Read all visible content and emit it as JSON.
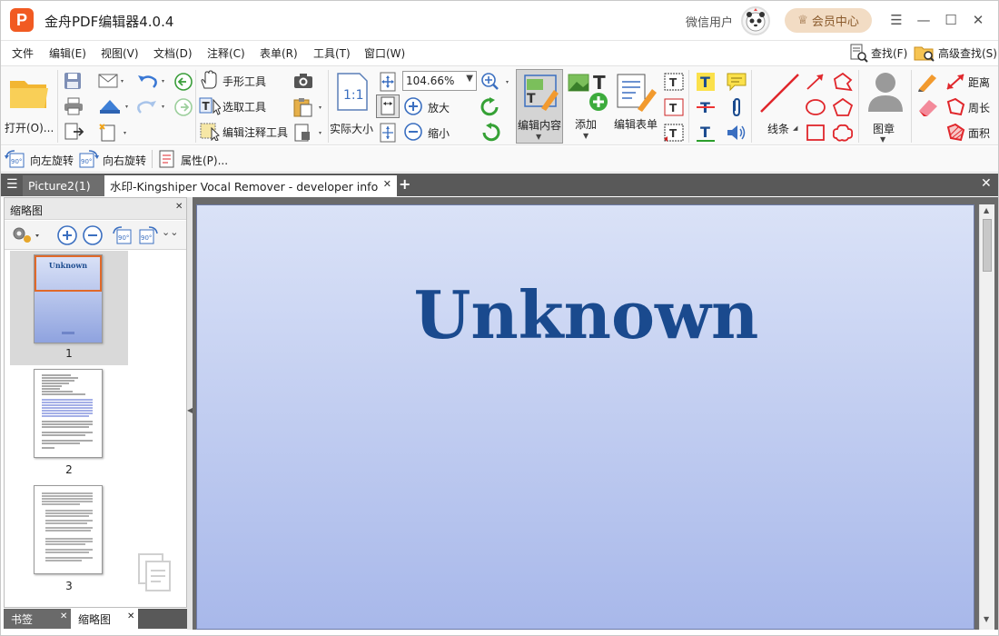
{
  "app": {
    "title": "金舟PDF编辑器4.0.4",
    "logo_letter": "P",
    "user": "微信用户",
    "vip_label": "会员中心",
    "brand_color": "#f15a22"
  },
  "window_controls": {
    "menu": "☰",
    "minimize": "—",
    "maximize": "☐",
    "close": "✕"
  },
  "menu": {
    "items": [
      "文件",
      "编辑(E)",
      "视图(V)",
      "文档(D)",
      "注释(C)",
      "表单(R)",
      "工具(T)",
      "窗口(W)"
    ],
    "find": "查找(F)",
    "advanced_find": "高级查找(S)"
  },
  "ribbon": {
    "open": "打开(O)...",
    "hand_tool": "手形工具",
    "select_tool": "选取工具",
    "edit_annot_tool": "编辑注释工具",
    "actual_size": "实际大小",
    "zoom_value": "104.66%",
    "zoom_in": "放大",
    "zoom_out": "缩小",
    "edit_content": "编辑内容",
    "add": "添加",
    "edit_form": "编辑表单",
    "line": "线条",
    "stamp": "图章",
    "distance": "距离",
    "perimeter": "周长",
    "area": "面积"
  },
  "quickbar": {
    "rotate_left": "向左旋转",
    "rotate_right": "向右旋转",
    "properties": "属性(P)..."
  },
  "tabs": [
    {
      "label": "Picture2(1)",
      "active": false
    },
    {
      "label": "水印-Kingshiper Vocal Remover - developer info...",
      "active": true
    }
  ],
  "panel": {
    "title": "缩略图",
    "pages": [
      "1",
      "2",
      "3"
    ],
    "cover_title": "Unknown",
    "bottom_tabs": [
      "书签",
      "缩略图"
    ]
  },
  "document": {
    "title": "Unknown"
  }
}
